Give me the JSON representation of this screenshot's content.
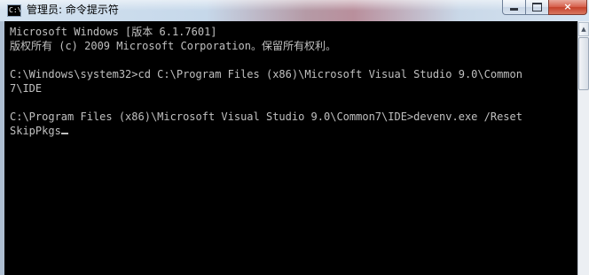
{
  "window": {
    "title": "管理员: 命令提示符",
    "icon_label": "C:\\",
    "controls": {
      "minimize": "minimize-icon",
      "maximize": "maximize-icon",
      "close": "×"
    }
  },
  "console": {
    "lines": [
      "Microsoft Windows [版本 6.1.7601]",
      "版权所有 (c) 2009 Microsoft Corporation。保留所有权利。",
      "",
      "C:\\Windows\\system32>cd C:\\Program Files (x86)\\Microsoft Visual Studio 9.0\\Common",
      "7\\IDE",
      "",
      "C:\\Program Files (x86)\\Microsoft Visual Studio 9.0\\Common7\\IDE>devenv.exe /Reset"
    ],
    "input_line": "SkipPkgs",
    "colors": {
      "background": "#000000",
      "text": "#c0c0c0"
    }
  }
}
